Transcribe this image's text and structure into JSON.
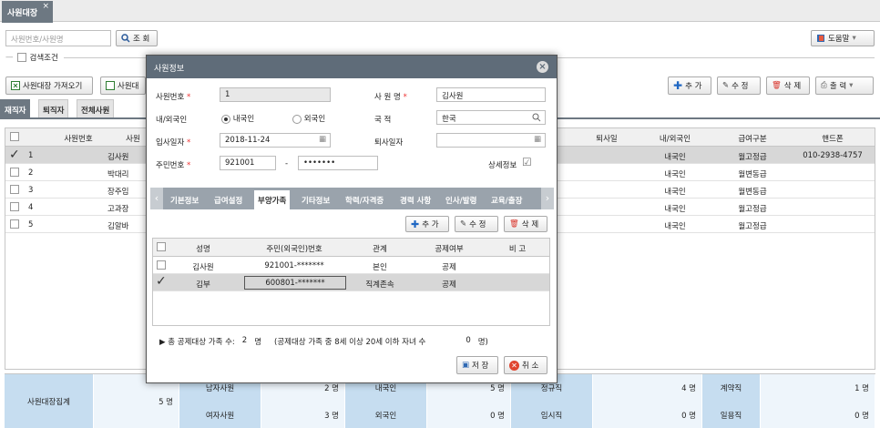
{
  "tabs": [
    {
      "label": "사원대장",
      "close": "×"
    }
  ],
  "search": {
    "placeholder": "사원번호/사원명",
    "button": "조 회"
  },
  "help_label": "도움말",
  "condition_label": "검색조건",
  "toolbar": {
    "import_label": "사원대장 가져오기",
    "import2_label": "사원대",
    "add": "추 가",
    "edit": "수 정",
    "delete": "삭 제",
    "print": "출 력"
  },
  "sub_tabs": [
    "재직자",
    "퇴직자",
    "전체사원"
  ],
  "grid": {
    "headers": {
      "emp_no": "사원번호",
      "name": "사원",
      "retire": "퇴사일",
      "domestic": "내/외국인",
      "pay": "급여구분",
      "phone": "핸드폰"
    },
    "rows": [
      {
        "no": "1",
        "name": "김사원",
        "domestic": "내국인",
        "pay": "월고정급",
        "phone": "010-2938-4757",
        "checked": true
      },
      {
        "no": "2",
        "name": "박대리",
        "domestic": "내국인",
        "pay": "월변동급",
        "phone": "",
        "checked": false
      },
      {
        "no": "3",
        "name": "장주임",
        "domestic": "내국인",
        "pay": "월변동급",
        "phone": "",
        "checked": false
      },
      {
        "no": "4",
        "name": "고과장",
        "domestic": "내국인",
        "pay": "월고정급",
        "phone": "",
        "checked": false
      },
      {
        "no": "5",
        "name": "김알바",
        "domestic": "내국인",
        "pay": "월고정급",
        "phone": "",
        "checked": false
      }
    ]
  },
  "summary": {
    "title": "사원대장집계",
    "total": "5 명",
    "c1": {
      "label": "남자사원",
      "value": "2 명"
    },
    "c1b": {
      "label": "여자사원",
      "value": "3 명"
    },
    "c2": {
      "label": "내국인",
      "value": "5 명"
    },
    "c2b": {
      "label": "외국인",
      "value": "0 명"
    },
    "c3": {
      "label": "정규직",
      "value": "4 명"
    },
    "c3b": {
      "label": "임시직",
      "value": "0 명"
    },
    "c4": {
      "label": "계약직",
      "value": "1 명"
    },
    "c4b": {
      "label": "일용직",
      "value": "0 명"
    }
  },
  "modal": {
    "title": "사원정보",
    "emp_no_label": "사원번호",
    "emp_no": "1",
    "name_label": "사 원 명",
    "name": "김사원",
    "nationality_label": "내/외국인",
    "domestic": "내국인",
    "foreign": "외국인",
    "country_label": "국   적",
    "country": "한국",
    "hire_label": "입사일자",
    "hire": "2018-11-24",
    "retire_label": "퇴사일자",
    "retire": "",
    "resident_label": "주민번호",
    "resident_front": "921001",
    "resident_sep": "-",
    "resident_back": "•••••••",
    "detail_label": "상세정보",
    "tabs": [
      "기본정보",
      "급여설정",
      "부양가족",
      "기타정보",
      "학력/자격증",
      "경력 사항",
      "인사/발령",
      "교육/출장"
    ],
    "add": "추 가",
    "edit": "수 정",
    "delete": "삭 제",
    "family_headers": {
      "name": "성명",
      "resident": "주민(외국인)번호",
      "relation": "관계",
      "deduct": "공제여부",
      "note": "비 고"
    },
    "family_rows": [
      {
        "name": "김사원",
        "resident": "921001-*******",
        "relation": "본인",
        "deduct": "공제",
        "checked": false
      },
      {
        "name": "김부",
        "resident": "600801-*******",
        "relation": "직계존속",
        "deduct": "공제",
        "checked": true
      }
    ],
    "footer_text": "▶ 총 공제대상 가족 수:",
    "footer_count": "2",
    "footer_unit": "명",
    "footer_note": "(공제대상 가족 중 8세 이상 20세 이하 자녀 수",
    "footer_child": "0",
    "footer_child_unit": "명)",
    "save": "저 장",
    "cancel": "취 소"
  },
  "colors": {
    "accent": "#6d7882",
    "summary_label": "#c6ddf0",
    "summary_value": "#eef5fb"
  }
}
